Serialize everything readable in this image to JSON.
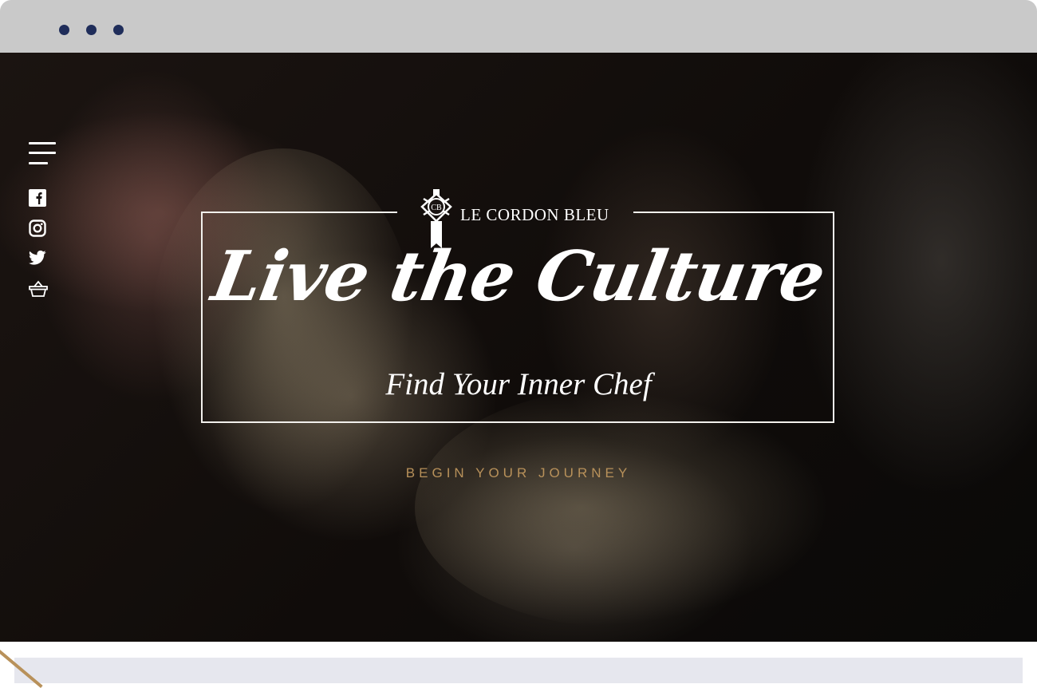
{
  "browser": {
    "dots_color": "#1f2d5a",
    "chrome_color": "#c9c9c9"
  },
  "sidebar": {
    "menu_icon": "hamburger-menu-icon",
    "social_icons": [
      "facebook-icon",
      "instagram-icon",
      "twitter-icon",
      "basket-icon"
    ]
  },
  "hero": {
    "brand": "LE CORDON BLEU",
    "headline": "Live the Culture",
    "subheadline": "Find Your Inner Chef",
    "cta_label": "BEGIN YOUR JOURNEY",
    "cta_color": "#b8915a",
    "frame_color": "#f2f0ec"
  },
  "below": {
    "panel_color": "#e6e7ee"
  }
}
